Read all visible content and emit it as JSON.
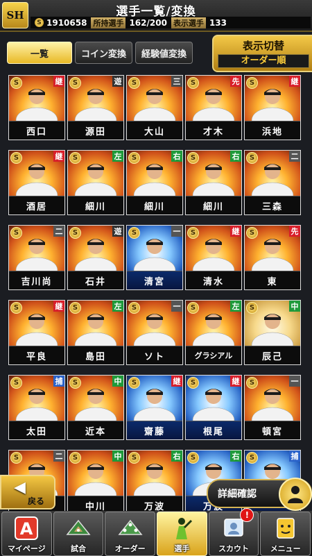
{
  "header": {
    "logo_text": "SH",
    "title": "選手一覧/変換",
    "coin_symbol": "S",
    "coins": "1910658",
    "owned_label": "所持選手",
    "owned_value": "162/200",
    "shown_label": "表示選手",
    "shown_value": "133"
  },
  "tabs": [
    "一覧",
    "コイン変換",
    "経験値変換"
  ],
  "display_toggle": {
    "label": "表示切替",
    "value": "オーダー順"
  },
  "cards": [
    {
      "name": "西口",
      "pos": "継",
      "pos_color": "#d81e2a",
      "style": "fire"
    },
    {
      "name": "源田",
      "pos": "遊",
      "pos_color": "#333333",
      "style": "fire"
    },
    {
      "name": "大山",
      "pos": "三",
      "pos_color": "#4a4a4a",
      "style": "fire"
    },
    {
      "name": "才木",
      "pos": "先",
      "pos_color": "#d81e2a",
      "style": "fire"
    },
    {
      "name": "浜地",
      "pos": "継",
      "pos_color": "#d81e2a",
      "style": "fire"
    },
    {
      "name": "酒居",
      "pos": "継",
      "pos_color": "#d81e2a",
      "style": "fire"
    },
    {
      "name": "細川",
      "pos": "左",
      "pos_color": "#1f9a3a",
      "style": "fire"
    },
    {
      "name": "細川",
      "pos": "右",
      "pos_color": "#1f9a3a",
      "style": "fire"
    },
    {
      "name": "細川",
      "pos": "右",
      "pos_color": "#1f9a3a",
      "style": "fire"
    },
    {
      "name": "三森",
      "pos": "二",
      "pos_color": "#555555",
      "style": "fire"
    },
    {
      "name": "吉川尚",
      "pos": "二",
      "pos_color": "#555555",
      "style": "fire"
    },
    {
      "name": "石井",
      "pos": "遊",
      "pos_color": "#333333",
      "style": "fire"
    },
    {
      "name": "清宮",
      "pos": "一",
      "pos_color": "#555555",
      "style": "blue"
    },
    {
      "name": "清水",
      "pos": "継",
      "pos_color": "#d81e2a",
      "style": "fire"
    },
    {
      "name": "東",
      "pos": "先",
      "pos_color": "#d81e2a",
      "style": "fire"
    },
    {
      "name": "平良",
      "pos": "継",
      "pos_color": "#d81e2a",
      "style": "fire"
    },
    {
      "name": "島田",
      "pos": "左",
      "pos_color": "#1f9a3a",
      "style": "fire"
    },
    {
      "name": "ソト",
      "pos": "一",
      "pos_color": "#555555",
      "style": "fire"
    },
    {
      "name": "グラシアル",
      "pos": "左",
      "pos_color": "#1f9a3a",
      "style": "fire"
    },
    {
      "name": "辰己",
      "pos": "中",
      "pos_color": "#1f9a3a",
      "style": "light"
    },
    {
      "name": "太田",
      "pos": "捕",
      "pos_color": "#2a62c9",
      "style": "fire"
    },
    {
      "name": "近本",
      "pos": "中",
      "pos_color": "#1f9a3a",
      "style": "fire"
    },
    {
      "name": "齋藤",
      "pos": "継",
      "pos_color": "#d81e2a",
      "style": "blue"
    },
    {
      "name": "根尾",
      "pos": "継",
      "pos_color": "#d81e2a",
      "style": "blue"
    },
    {
      "name": "頓宮",
      "pos": "一",
      "pos_color": "#555555",
      "style": "fire"
    },
    {
      "name": "",
      "pos": "二",
      "pos_color": "#555555",
      "style": "fire"
    },
    {
      "name": "中川",
      "pos": "中",
      "pos_color": "#1f9a3a",
      "style": "fire"
    },
    {
      "name": "万波",
      "pos": "右",
      "pos_color": "#1f9a3a",
      "style": "fire"
    },
    {
      "name": "万波",
      "pos": "右",
      "pos_color": "#1f9a3a",
      "style": "blue"
    },
    {
      "name": "",
      "pos": "捕",
      "pos_color": "#2a62c9",
      "style": "blue"
    }
  ],
  "back_label": "戻る",
  "detail_label": "詳細確認",
  "nav": [
    {
      "label": "マイページ",
      "icon": "letter-a-icon"
    },
    {
      "label": "試合",
      "icon": "stadium-icon"
    },
    {
      "label": "オーダー",
      "icon": "field-order-icon"
    },
    {
      "label": "選手",
      "icon": "player-icon"
    },
    {
      "label": "スカウト",
      "icon": "scout-icon"
    },
    {
      "label": "メニュー",
      "icon": "menu-icon"
    }
  ],
  "scout_badge": "!"
}
